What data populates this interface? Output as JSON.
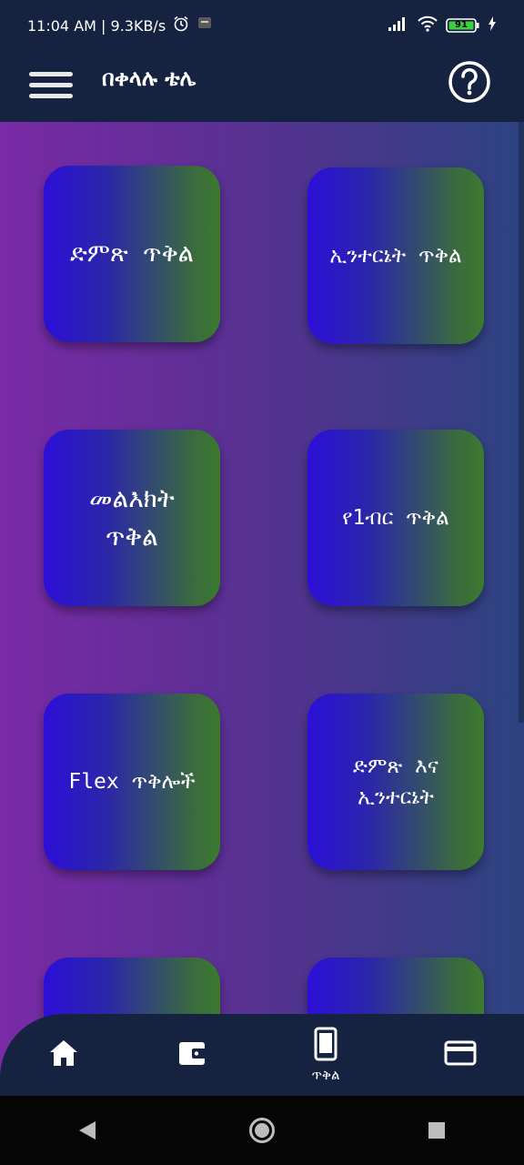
{
  "status_bar": {
    "time_network": "11:04 AM | 9.3KB/s",
    "battery": "91"
  },
  "app_bar": {
    "title": "በቀላሉ ቴሌ"
  },
  "tiles": [
    {
      "label": "ድምጽ  ጥቅል"
    },
    {
      "label": "ኢንተርኔት ጥቅል"
    },
    {
      "label": "መልእክት\nጥቅል"
    },
    {
      "label": "የ1ብር ጥቅል"
    },
    {
      "label": "Flex ጥቅሎች"
    },
    {
      "label": "ድምጽ እና\nኢንተርኔት"
    }
  ],
  "bottom_nav": {
    "active_label": "ጥቅል"
  },
  "colors": {
    "bar": "#152240",
    "bg_left": "#7a2aa6",
    "bg_right": "#2c4380",
    "tile_left": "#2c0fd8",
    "tile_right": "#3b7a2d"
  },
  "icons": [
    "alarm-icon",
    "chat-icon",
    "signal-icon",
    "wifi-icon",
    "battery-icon",
    "charging-icon",
    "menu-icon",
    "help-icon",
    "home-icon",
    "wallet-icon",
    "phone-icon",
    "card-icon",
    "back-icon",
    "home-circle-icon",
    "recents-icon"
  ]
}
